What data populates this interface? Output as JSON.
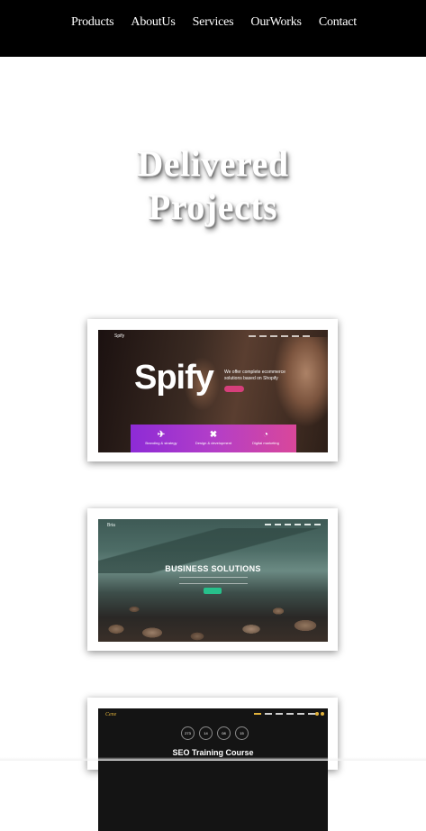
{
  "nav": {
    "items": [
      "Products",
      "AboutUs",
      "Services",
      "OurWorks",
      "Contact"
    ]
  },
  "section": {
    "title_line1": "Delivered",
    "title_line2": "Projects"
  },
  "projects": [
    {
      "brand": "Spify",
      "logo": "Spify",
      "hero_text": "Spify",
      "tagline": "We offer complete ecommerce solutions based on Shopify",
      "features": [
        "Branding & strategy",
        "Design & development",
        "Digital marketing"
      ],
      "feature_icons": [
        "rocket-icon",
        "tools-icon",
        "pie-chart-icon"
      ],
      "accent": "#d63f7b"
    },
    {
      "brand": "Bria",
      "logo": "Bria",
      "hero_text": "BUSINESS SOLUTIONS",
      "accent": "#27c08b"
    },
    {
      "brand": "Cene",
      "logo": "Cene",
      "timers": [
        "273",
        "14",
        "08",
        "15"
      ],
      "hero_text": "SEO Training Course",
      "accent": "#e1b23c"
    }
  ]
}
